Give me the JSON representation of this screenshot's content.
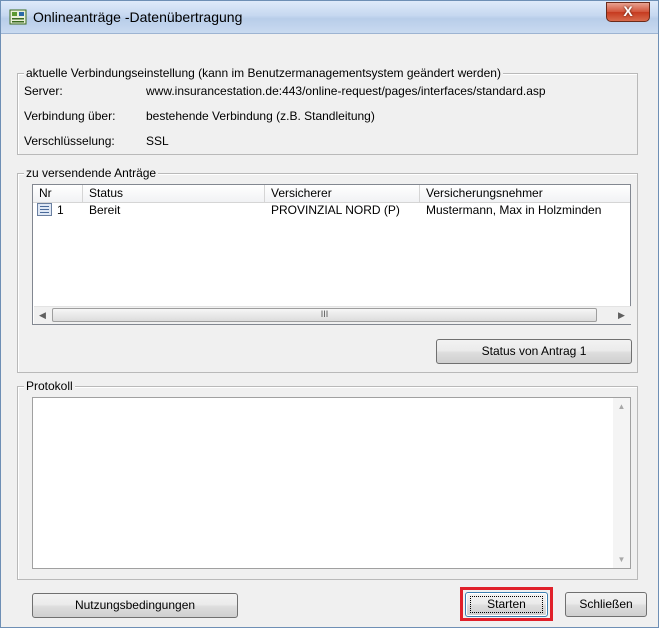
{
  "window": {
    "title": "Onlineanträge -Datenübertragung",
    "close_glyph": "X"
  },
  "connection": {
    "legend": "aktuelle Verbindungseinstellung (kann im Benutzermanagementsystem geändert werden)",
    "server_label": "Server:",
    "server_value": "www.insurancestation.de:443/online-request/pages/interfaces/standard.asp",
    "via_label": "Verbindung über:",
    "via_value": "bestehende Verbindung (z.B. Standleitung)",
    "encryption_label": "Verschlüsselung:",
    "encryption_value": "SSL"
  },
  "requests": {
    "legend": "zu versendende Anträge",
    "columns": [
      "Nr",
      "Status",
      "Versicherer",
      "Versicherungsnehmer"
    ],
    "rows": [
      {
        "nr": "1",
        "status": "Bereit",
        "insurer": "PROVINZIAL NORD (P)",
        "policyholder": "Mustermann, Max in Holzminden",
        "icon": "document-icon"
      }
    ],
    "scroll_thumb_grip": "III",
    "status_button": "Status von Antrag 1"
  },
  "protocol": {
    "legend": "Protokoll",
    "content": ""
  },
  "footer": {
    "terms_button": "Nutzungsbedingungen",
    "start_button": "Starten",
    "close_button": "Schließen"
  },
  "colors": {
    "highlight": "#e0202a",
    "close_button": "#c63a1f"
  }
}
